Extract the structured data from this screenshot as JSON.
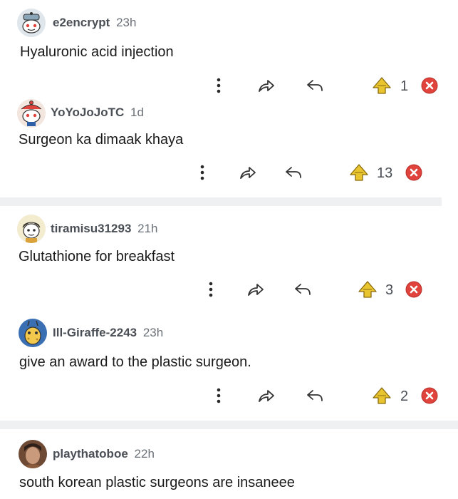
{
  "comments": [
    {
      "user": "e2encrypt",
      "age": "23h",
      "text": "Hyaluronic acid injection",
      "score": "1"
    },
    {
      "user": "YoYoJoJoTC",
      "age": "1d",
      "text": "Surgeon ka dimaak khaya",
      "score": "13"
    },
    {
      "user": "tiramisu31293",
      "age": "21h",
      "text": "Glutathione for breakfast",
      "score": "3"
    },
    {
      "user": "Ill-Giraffe-2243",
      "age": "23h",
      "text": "give an award to the plastic surgeon.",
      "score": "2"
    },
    {
      "user": "playthatoboe",
      "age": "22h",
      "text": "south korean plastic surgeons are insaneee"
    }
  ],
  "icons": {
    "more": "more-vertical-icon",
    "share": "share-forward-icon",
    "reply": "reply-icon",
    "upvote": "gold-upvote-icon",
    "downvote": "red-downvote-icon"
  },
  "colors": {
    "upvote": "#e8c52e",
    "downvote": "#e0433b",
    "divider": "#eef0f2",
    "username": "#4a4f55"
  }
}
